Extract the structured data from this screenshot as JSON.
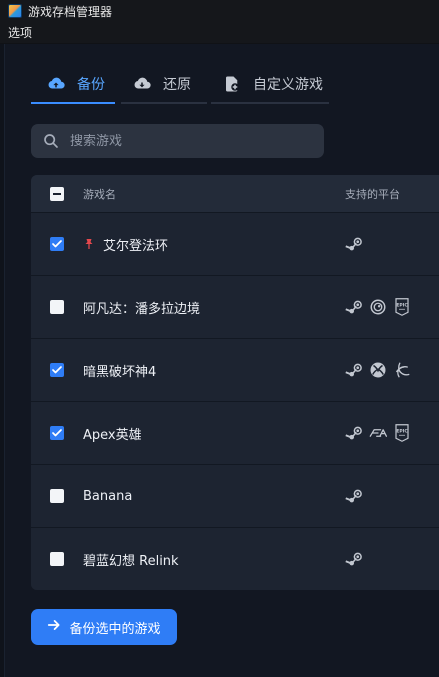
{
  "window": {
    "title": "游戏存档管理器"
  },
  "menubar": {
    "options_label": "选项"
  },
  "tabs": [
    {
      "label": "备份",
      "icon": "cloud-upload-icon",
      "active": true
    },
    {
      "label": "还原",
      "icon": "cloud-download-icon",
      "active": false
    },
    {
      "label": "自定义游戏",
      "icon": "file-plus-icon",
      "active": false
    }
  ],
  "search": {
    "placeholder": "搜索游戏",
    "value": ""
  },
  "table": {
    "headers": {
      "name": "游戏名",
      "platforms": "支持的平台"
    },
    "rows": [
      {
        "name": "艾尔登法环",
        "checked": true,
        "pinned": true,
        "platforms": [
          "steam"
        ]
      },
      {
        "name": "阿凡达：潘多拉边境",
        "checked": false,
        "pinned": false,
        "platforms": [
          "steam",
          "ubisoft",
          "epic"
        ]
      },
      {
        "name": "暗黑破坏神4",
        "checked": true,
        "pinned": false,
        "platforms": [
          "steam",
          "xbox",
          "battlenet"
        ]
      },
      {
        "name": "Apex英雄",
        "checked": true,
        "pinned": false,
        "platforms": [
          "steam",
          "ea",
          "epic"
        ]
      },
      {
        "name": "Banana",
        "checked": false,
        "pinned": false,
        "platforms": [
          "steam"
        ]
      },
      {
        "name": "碧蓝幻想 Relink",
        "checked": false,
        "pinned": false,
        "platforms": [
          "steam"
        ]
      }
    ]
  },
  "actions": {
    "backup_selected_label": "备份选中的游戏"
  },
  "colors": {
    "accent": "#2f7df6",
    "active_tab": "#58a6ff",
    "pin": "#e5484d"
  }
}
